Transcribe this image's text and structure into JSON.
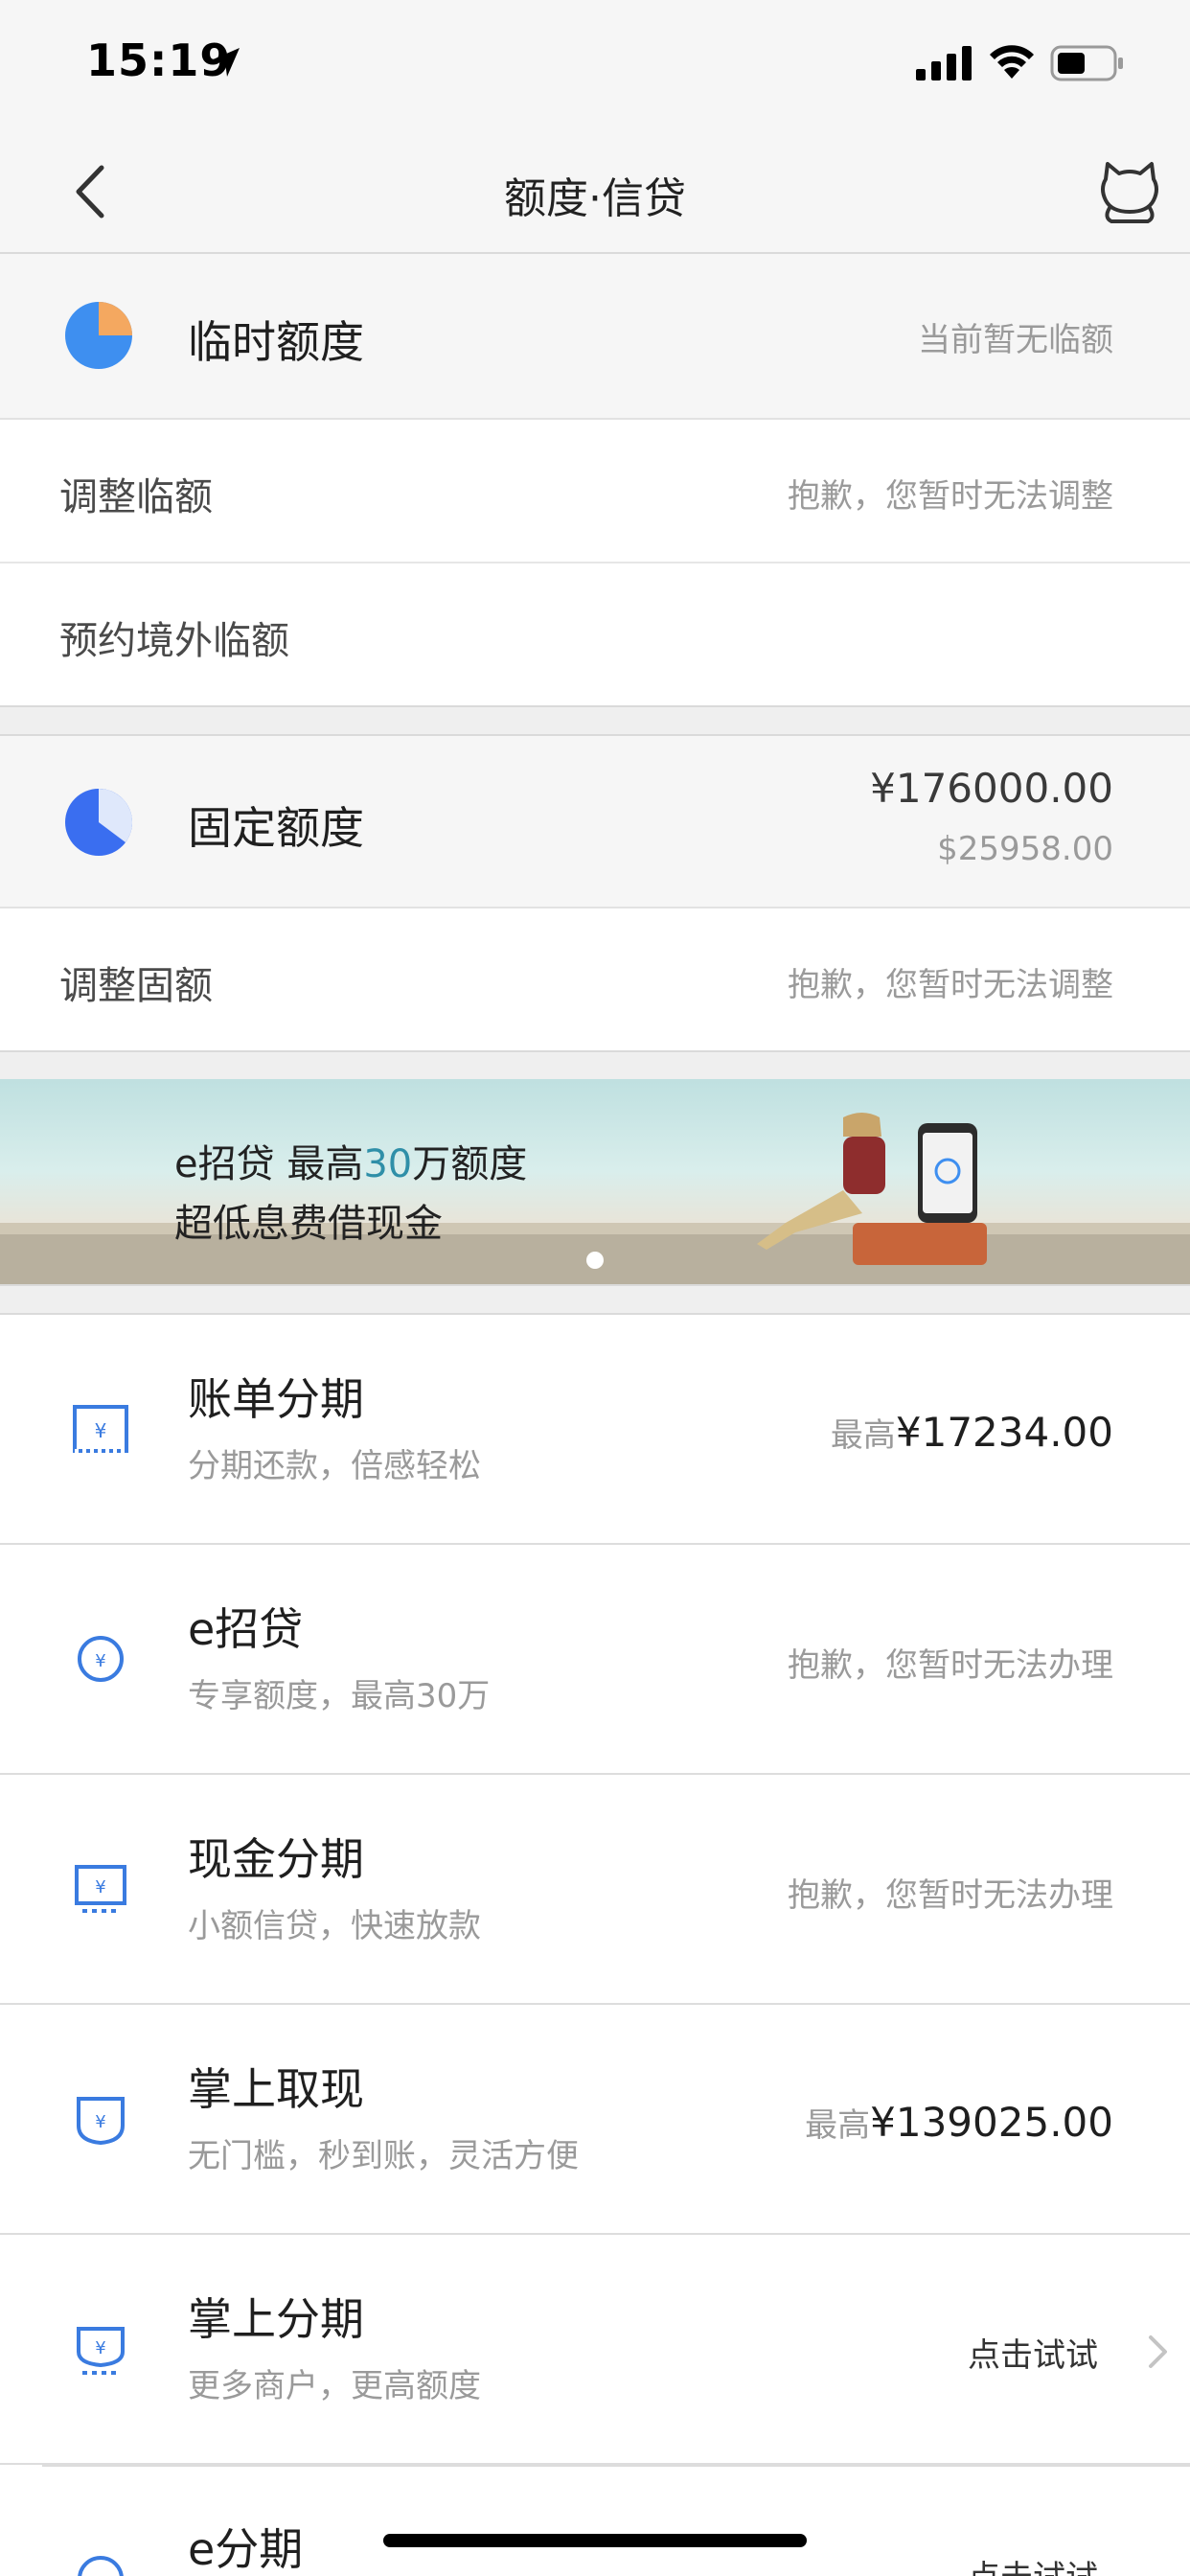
{
  "status_bar": {
    "time": "15:19"
  },
  "nav": {
    "title": "额度·信贷"
  },
  "temp_limit": {
    "title": "临时额度",
    "status": "当前暂无临额",
    "rows": [
      {
        "label": "调整临额",
        "value": "抱歉，您暂时无法调整"
      },
      {
        "label": "预约境外临额",
        "value": ""
      }
    ]
  },
  "fixed_limit": {
    "title": "固定额度",
    "cny_amount": "¥176000.00",
    "usd_amount": "$25958.00",
    "rows": [
      {
        "label": "调整固额",
        "value": "抱歉，您暂时无法调整"
      }
    ]
  },
  "banner": {
    "line1_prefix": "e招贷  最高",
    "line1_highlight": "30",
    "line1_suffix": "万额度",
    "line2": "超低息费借现金"
  },
  "products": [
    {
      "title": "账单分期",
      "subtitle": "分期还款，倍感轻松",
      "prefix": "最高",
      "amount": "¥17234.00",
      "status": ""
    },
    {
      "title": "e招贷",
      "subtitle": "专享额度，最高30万",
      "prefix": "",
      "amount": "",
      "status": "抱歉，您暂时无法办理"
    },
    {
      "title": "现金分期",
      "subtitle": "小额信贷，快速放款",
      "prefix": "",
      "amount": "",
      "status": "抱歉，您暂时无法办理"
    },
    {
      "title": "掌上取现",
      "subtitle": "无门槛，秒到账，灵活方便",
      "prefix": "最高",
      "amount": "¥139025.00",
      "status": ""
    },
    {
      "title": "掌上分期",
      "subtitle": "更多商户，更高额度",
      "prefix": "",
      "amount": "",
      "status": "点击试试"
    },
    {
      "title": "e分期",
      "subtitle": "",
      "prefix": "",
      "amount": "",
      "status": "点击试试"
    }
  ],
  "colors": {
    "accent_blue": "#3a7be0",
    "pie_orange": "#f4a860",
    "banner_highlight": "#2f8fa8"
  }
}
